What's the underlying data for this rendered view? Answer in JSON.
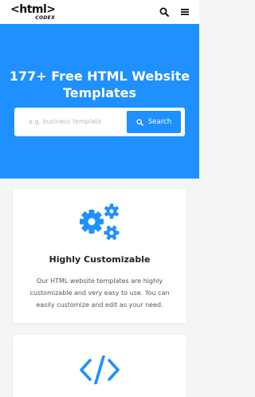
{
  "navbar": {
    "logo_main": "<html>",
    "logo_sub": "CODEX",
    "icons": [
      "search-icon",
      "menu-icon"
    ]
  },
  "hero": {
    "title": "177+ Free HTML Website Templates",
    "search": {
      "placeholder": "e.g. business template",
      "button_label": "Search"
    }
  },
  "features": [
    {
      "icon": "gears-icon",
      "title": "Highly Customizable",
      "text": "Our HTML website templates are highly customizable and very easy to use. You can easily customize and edit as your need."
    },
    {
      "icon": "code-icon"
    }
  ],
  "colors": {
    "brand_blue": "#1e90ff",
    "background": "#f5f5f5",
    "card": "#ffffff"
  }
}
